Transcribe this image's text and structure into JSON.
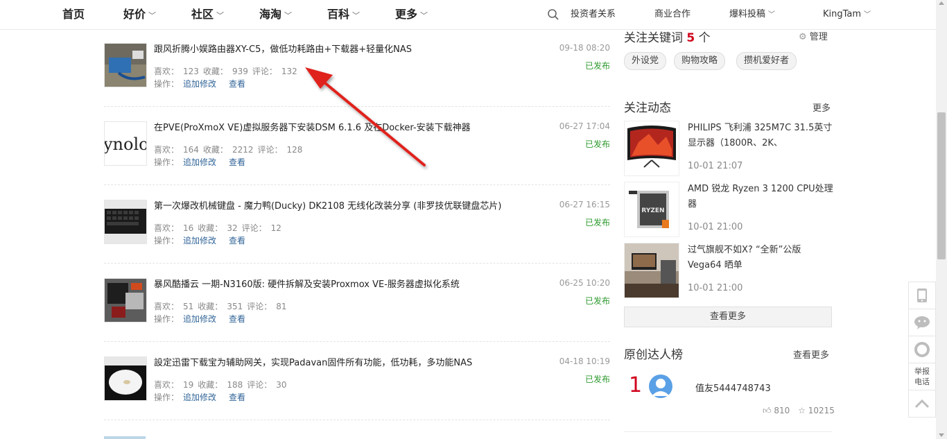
{
  "nav": {
    "items": [
      {
        "label": "首页",
        "caret": false
      },
      {
        "label": "好价",
        "caret": true
      },
      {
        "label": "社区",
        "caret": true
      },
      {
        "label": "海淘",
        "caret": true
      },
      {
        "label": "百科",
        "caret": true
      },
      {
        "label": "更多",
        "caret": true
      }
    ],
    "right": [
      {
        "label": "投资者关系",
        "caret": false
      },
      {
        "label": "商业合作",
        "caret": false
      },
      {
        "label": "爆料投稿",
        "caret": true
      },
      {
        "label": "KingTam",
        "caret": true
      }
    ]
  },
  "articles": [
    {
      "title": "跟风折腾小娱路由器XY-C5，做低功耗路由+下载器+轻量化NAS",
      "likes_label": "喜欢：",
      "likes": "123",
      "favs_label": "收藏：",
      "favs": "939",
      "comments_label": "评论：",
      "comments": "132",
      "ops_label": "操作：",
      "edit": "追加修改",
      "view": "查看",
      "date": "09-18 08:20",
      "status": "已发布",
      "thumb": "router"
    },
    {
      "title": "在PVE(ProXmoX VE)虚拟服务器下安装DSM 6.1.6 及在Docker-安装下载神器",
      "likes_label": "喜欢：",
      "likes": "164",
      "favs_label": "收藏：",
      "favs": "2212",
      "comments_label": "评论：",
      "comments": "128",
      "ops_label": "操作：",
      "edit": "追加修改",
      "view": "查看",
      "date": "06-27 17:04",
      "status": "已发布",
      "thumb": "logo-text",
      "thumb_text": "ynolo"
    },
    {
      "title": "第一次爆改机械键盘 - 魔力鸭(Ducky) DK2108 无线化改装分享 (非罗技优联键盘芯片)",
      "likes_label": "喜欢：",
      "likes": "16",
      "favs_label": "收藏：",
      "favs": "32",
      "comments_label": "评论：",
      "comments": "12",
      "ops_label": "操作：",
      "edit": "追加修改",
      "view": "查看",
      "date": "06-27 16:15",
      "status": "已发布",
      "thumb": "keyboard"
    },
    {
      "title": "暴风酷播云 一期-N3160版: 硬件拆解及安装Proxmox VE-服务器虚拟化系统",
      "likes_label": "喜欢：",
      "likes": "51",
      "favs_label": "收藏：",
      "favs": "351",
      "comments_label": "评论：",
      "comments": "81",
      "ops_label": "操作：",
      "edit": "追加修改",
      "view": "查看",
      "date": "06-25 10:20",
      "status": "已发布",
      "thumb": "hardware"
    },
    {
      "title": "設定迅雷下载宝为辅助网关，实现Padavan固件所有功能，低功耗，多功能NAS",
      "likes_label": "喜欢：",
      "likes": "19",
      "favs_label": "收藏：",
      "favs": "188",
      "comments_label": "评论：",
      "comments": "30",
      "ops_label": "操作：",
      "edit": "追加修改",
      "view": "查看",
      "date": "04-18 10:19",
      "status": "已发布",
      "thumb": "device"
    }
  ],
  "keywords": {
    "title_prefix": "关注关键词",
    "count": "5",
    "title_suffix": "个",
    "manage": "管理",
    "tags": [
      "外设党",
      "购物攻略",
      "攒机爱好者"
    ]
  },
  "feed": {
    "title": "关注动态",
    "more": "更多",
    "items": [
      {
        "title": "PHILIPS 飞利浦 325M7C 31.5英寸显示器（1800R、2K、",
        "time": "10-01 21:07",
        "thumb": "monitor"
      },
      {
        "title": "AMD 锐龙 Ryzen 3 1200 CPU处理器",
        "time": "10-01 21:00",
        "thumb": "ryzen",
        "thumb_text": "RYZEN"
      },
      {
        "title": "过气旗舰不如X? “全新”公版Vega64 晒单",
        "time": "10-01 21:00",
        "thumb": "desk"
      }
    ],
    "see_more": "查看更多"
  },
  "ranking": {
    "title": "原创达人榜",
    "more": "查看更多",
    "rank": "1",
    "user": "值友5444748743",
    "likes": "810",
    "stars": "10215"
  },
  "tools": {
    "report": "举报\n电话"
  },
  "colors": {
    "accent_red": "#d0021b",
    "link_blue": "#336699",
    "status_green": "#2e9a2e"
  }
}
